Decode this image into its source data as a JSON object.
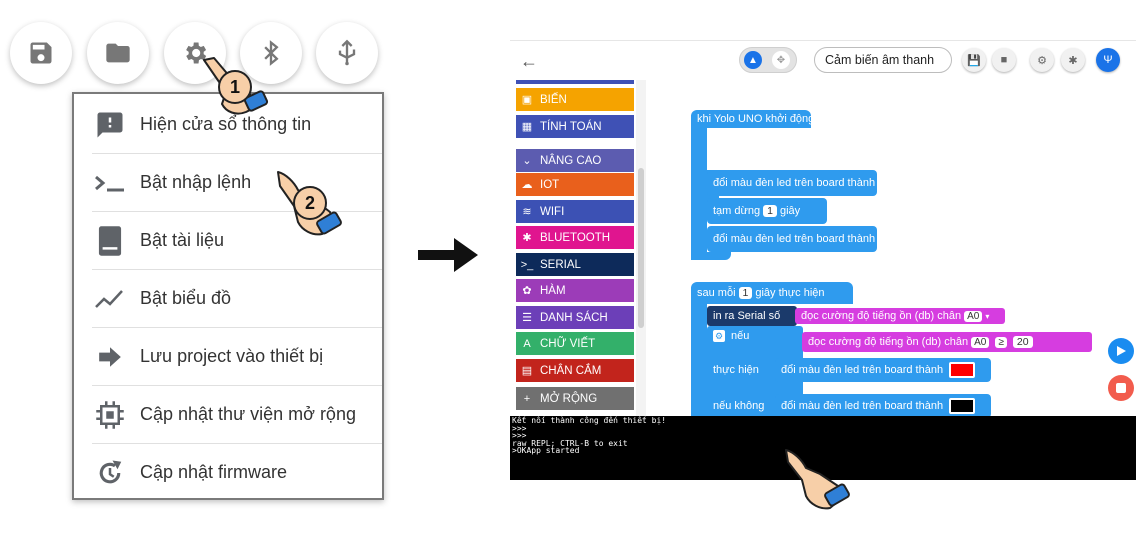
{
  "left_panel": {
    "toolbar_icons": [
      "save-icon",
      "folder-icon",
      "gear-icon",
      "bluetooth-icon",
      "usb-icon"
    ],
    "menu_items": [
      {
        "label": "Hiện cửa sổ thông tin",
        "icon": "info-icon"
      },
      {
        "label": "Bật nhập lệnh",
        "icon": "terminal-icon"
      },
      {
        "label": "Bật tài liệu",
        "icon": "document-icon"
      },
      {
        "label": "Bật biểu đồ",
        "icon": "chart-icon"
      },
      {
        "label": "Lưu project vào thiết bị",
        "icon": "arrow-right-icon"
      },
      {
        "label": "Cập nhật thư viện mở rộng",
        "icon": "chip-icon"
      },
      {
        "label": "Cập nhật firmware",
        "icon": "refresh-icon"
      }
    ],
    "step_badges": [
      "1",
      "2"
    ]
  },
  "right_panel": {
    "project_name": "Cảm biến âm thanh",
    "categories": [
      {
        "label": "BIẾN",
        "color": "#f5a300",
        "icon": "▣"
      },
      {
        "label": "TÍNH TOÁN",
        "color": "#3f51b5",
        "icon": "▦"
      },
      {
        "label": "NÂNG CAO",
        "color": "#5c5cb0",
        "icon": "⌄"
      },
      {
        "label": "IOT",
        "color": "#e9601c",
        "icon": "☁"
      },
      {
        "label": "WIFI",
        "color": "#3c51b4",
        "icon": "≋"
      },
      {
        "label": "BLUETOOTH",
        "color": "#e0158f",
        "icon": "✱"
      },
      {
        "label": "SERIAL",
        "color": "#0d2a5a",
        "icon": ">_"
      },
      {
        "label": "HÀM",
        "color": "#9c3cb8",
        "icon": "✿"
      },
      {
        "label": "DANH SÁCH",
        "color": "#6c3fb8",
        "icon": "☰"
      },
      {
        "label": "CHỮ VIẾT",
        "color": "#33b06a",
        "icon": "A"
      },
      {
        "label": "CHÂN CẮM",
        "color": "#c2241c",
        "icon": "▤"
      },
      {
        "label": "MỞ RỘNG",
        "color": "#707070",
        "icon": "+"
      }
    ],
    "blocks": {
      "start_hat": "khi Yolo UNO khởi động",
      "led1": "đổi màu đèn led trên board thành",
      "led1_color": "#2ae82a",
      "pause": "tạm dừng",
      "pause_num": "1",
      "pause_unit": "giây",
      "led2": "đổi màu đèn led trên board thành",
      "led2_color": "#000000",
      "loop_hat": "sau mỗi",
      "loop_num": "1",
      "loop_unit": "giây thực hiện",
      "print": "in ra Serial số",
      "read1": "đọc cường độ tiếng ồn (db) chân",
      "read1_pin": "A0",
      "if_label": "nếu",
      "read2": "đọc cường độ tiếng ồn (db) chân",
      "read2_pin": "A0",
      "op": "≥",
      "threshold": "20",
      "then_label": "thực hiện",
      "led3": "đổi màu đèn led trên board thành",
      "led3_color": "#ff0000",
      "else_label": "nếu không",
      "led4": "đổi màu đèn led trên board thành",
      "led4_color": "#000000"
    },
    "console_lines": [
      "Kết nối thành công đến thiết bị!",
      "",
      ">>>",
      ">>>",
      "raw REPL; CTRL-B to exit",
      ">OKApp started"
    ]
  }
}
